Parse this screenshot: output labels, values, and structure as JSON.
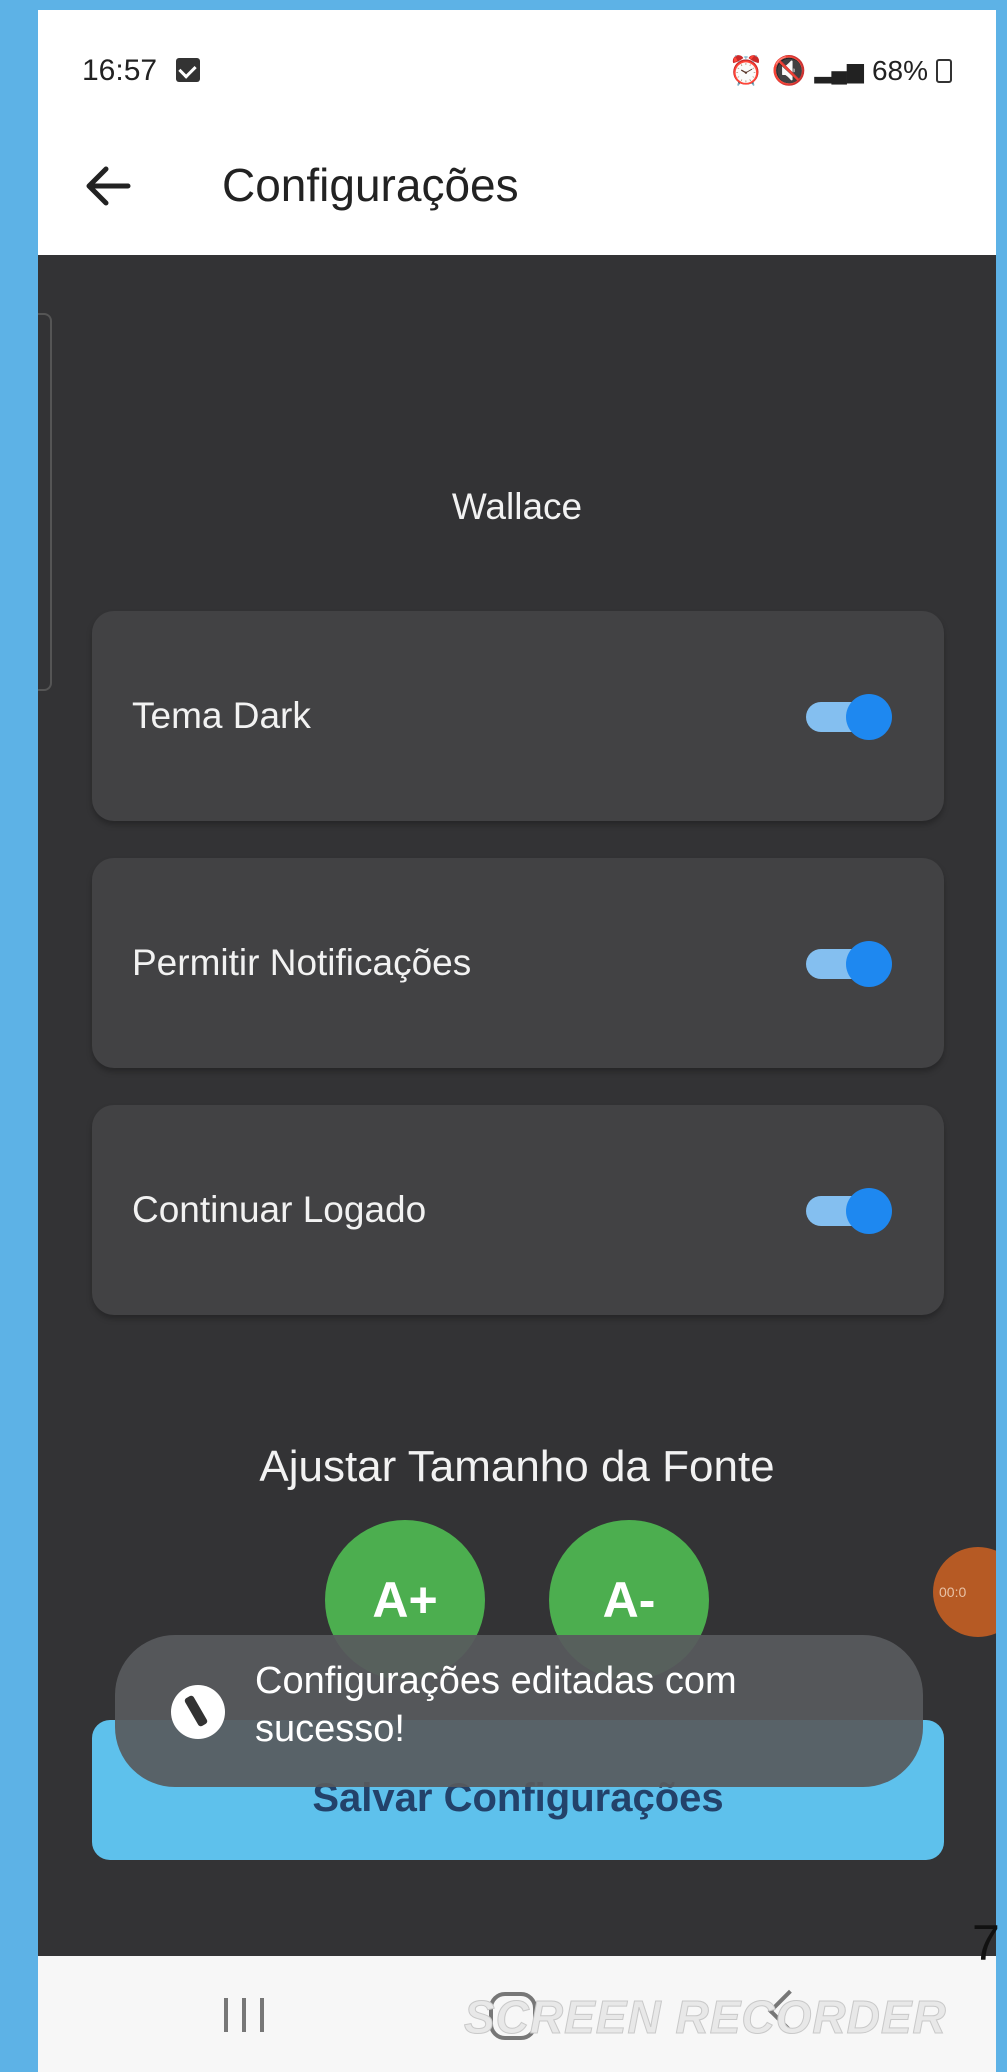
{
  "status_bar": {
    "time": "16:57",
    "icons": [
      "alarm-icon",
      "mute-icon",
      "volte-icon",
      "4g-icon",
      "signal-icon"
    ],
    "battery": "68%"
  },
  "app_bar": {
    "title": "Configurações"
  },
  "profile": {
    "name": "Wallace"
  },
  "settings": [
    {
      "label": "Tema Dark",
      "enabled": true
    },
    {
      "label": "Permitir Notificações",
      "enabled": true
    },
    {
      "label": "Continuar Logado",
      "enabled": true
    }
  ],
  "font_size": {
    "title": "Ajustar Tamanho da Fonte",
    "increase_label": "A+",
    "decrease_label": "A-"
  },
  "save_button": {
    "label": "Salvar Configurações"
  },
  "toast": {
    "message": "Configurações editadas com sucesso!"
  },
  "recorder": {
    "timer": "00:0",
    "watermark": "SCREEN RECORDER"
  },
  "page_number": "7",
  "colors": {
    "background": "#5db2e6",
    "screen": "#333335",
    "card": "#424244",
    "toggle_on": "#1e88f0",
    "font_button": "#4cae4f",
    "save_button": "#5ec1ec"
  }
}
